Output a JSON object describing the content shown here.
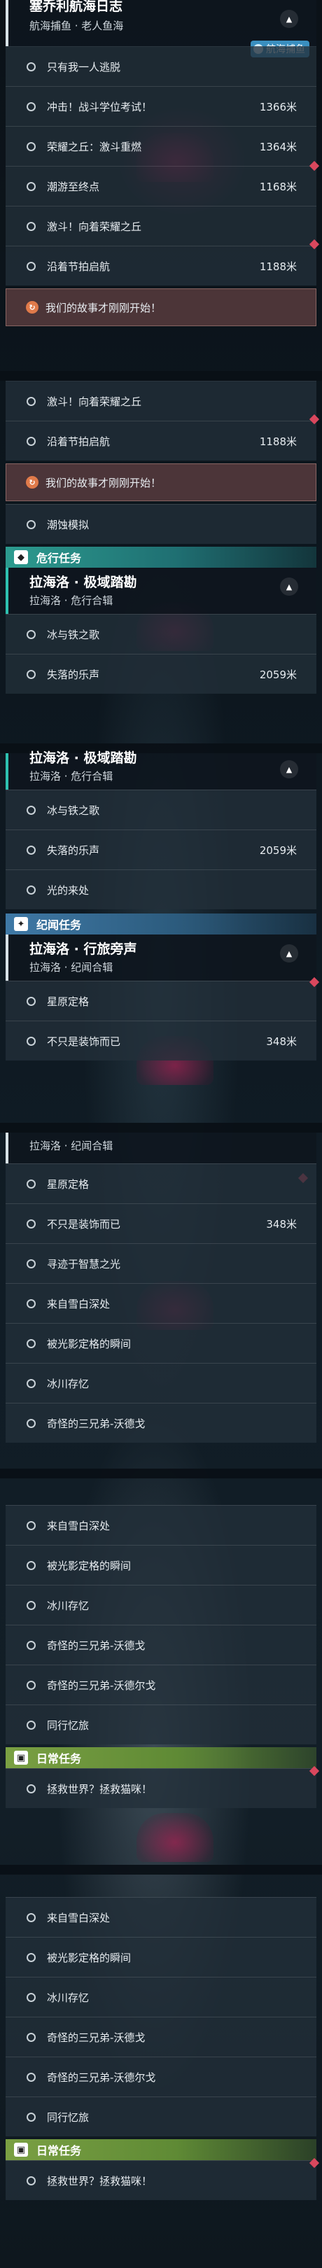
{
  "header": {
    "title": "塞乔利航海日志",
    "subtitle": "航海捕鱼 · 老人鱼海",
    "tag_label": "航海捕鱼"
  },
  "section1_items": [
    {
      "label": "只有我一人逃脱",
      "dist": ""
    },
    {
      "label": "冲击！战斗学位考试！",
      "dist": "1366米"
    },
    {
      "label": "荣耀之丘：激斗重燃",
      "dist": "1364米"
    },
    {
      "label": "潮游至终点",
      "dist": "1168米"
    },
    {
      "label": "激斗！向着荣耀之丘",
      "dist": ""
    },
    {
      "label": "沿着节拍启航",
      "dist": "1188米"
    }
  ],
  "story_highlight": "我们的故事才刚刚开始！",
  "section2_items": [
    {
      "label": "激斗！向着荣耀之丘",
      "dist": ""
    },
    {
      "label": "沿着节拍启航",
      "dist": "1188米"
    }
  ],
  "section2_after": {
    "label": "潮蚀模拟",
    "dist": ""
  },
  "category_danger": "危行任务",
  "group_lahailuo_jiyu": {
    "title": "拉海洛 · 极域踏勘",
    "subtitle": "拉海洛 · 危行合辑",
    "items": [
      {
        "label": "冰与铁之歌",
        "dist": ""
      },
      {
        "label": "失落的乐声",
        "dist": "2059米"
      }
    ]
  },
  "group_lahailuo_jiyu_cut": {
    "title": "拉海洛 · 极域踏勘",
    "subtitle": "拉海洛 · 危行合辑",
    "items": [
      {
        "label": "冰与铁之歌",
        "dist": ""
      },
      {
        "label": "失落的乐声",
        "dist": "2059米"
      },
      {
        "label": "光的来处",
        "dist": ""
      }
    ]
  },
  "category_jiwen": "纪闻任务",
  "group_lahailuo_xinglv": {
    "title": "拉海洛 · 行旅旁声",
    "subtitle": "拉海洛 · 纪闻合辑",
    "items": [
      {
        "label": "星原定格",
        "dist": ""
      },
      {
        "label": "不只是装饰而已",
        "dist": "348米"
      }
    ]
  },
  "section5": {
    "subtitle": "拉海洛 · 纪闻合辑",
    "items": [
      {
        "label": "星原定格",
        "dist": ""
      },
      {
        "label": "不只是装饰而已",
        "dist": "348米"
      },
      {
        "label": "寻迹于智慧之光",
        "dist": ""
      },
      {
        "label": "来自雪白深处",
        "dist": ""
      },
      {
        "label": "被光影定格的瞬间",
        "dist": ""
      },
      {
        "label": "冰川存忆",
        "dist": ""
      },
      {
        "label": "奇怪的三兄弟-沃德戈",
        "dist": ""
      }
    ]
  },
  "section6_items": [
    {
      "label": "来自雪白深处",
      "dist": ""
    },
    {
      "label": "被光影定格的瞬间",
      "dist": ""
    },
    {
      "label": "冰川存忆",
      "dist": ""
    },
    {
      "label": "奇怪的三兄弟-沃德戈",
      "dist": ""
    },
    {
      "label": "奇怪的三兄弟-沃德尔戈",
      "dist": ""
    },
    {
      "label": "同行忆旅",
      "dist": ""
    }
  ],
  "category_daily": "日常任务",
  "daily_item": "拯救世界？拯救猫咪！",
  "section7_items": [
    {
      "label": "来自雪白深处",
      "dist": ""
    },
    {
      "label": "被光影定格的瞬间",
      "dist": ""
    },
    {
      "label": "冰川存忆",
      "dist": ""
    },
    {
      "label": "奇怪的三兄弟-沃德戈",
      "dist": ""
    },
    {
      "label": "奇怪的三兄弟-沃德尔戈",
      "dist": ""
    },
    {
      "label": "同行忆旅",
      "dist": ""
    }
  ],
  "category_daily_2": "日常任务",
  "daily_item_2": "拯救世界？拯救猫咪！",
  "icons": {
    "toggle": "chevron-up-icon",
    "quest": "circle-icon",
    "story": "story-icon",
    "pin": "waypoint-marker-icon"
  },
  "colors": {
    "teal": "#2c9b8f",
    "blue": "#3f79a6",
    "green": "#7aa043",
    "pin": "#d9475d"
  }
}
